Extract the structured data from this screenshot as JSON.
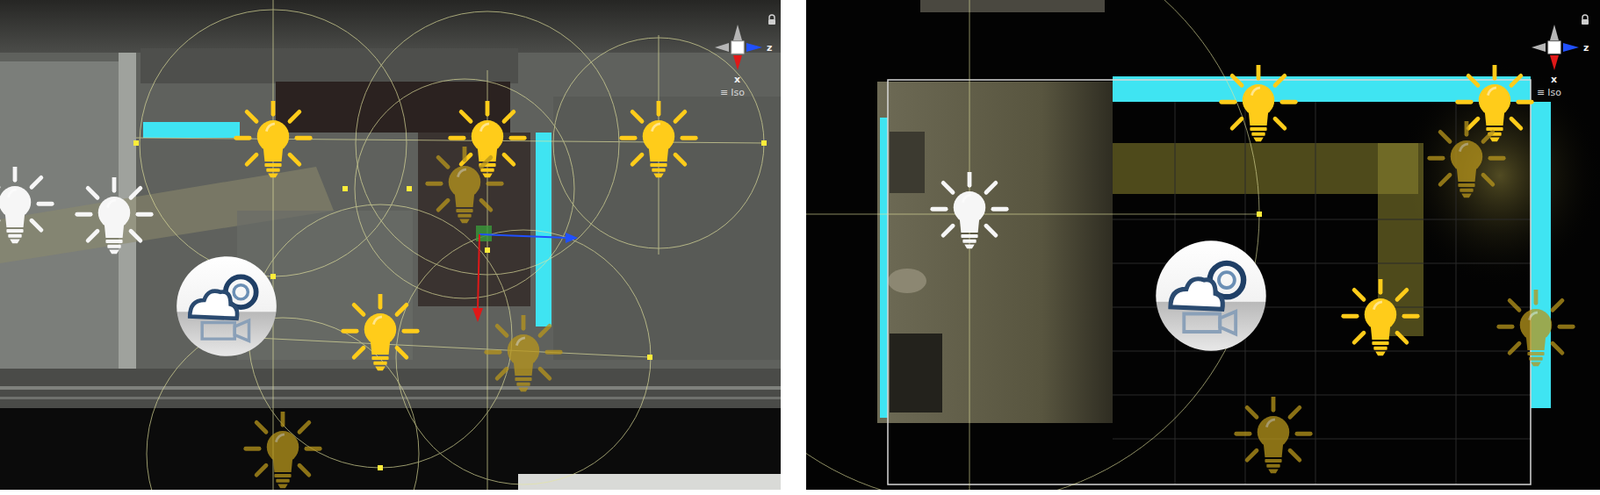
{
  "panels": [
    {
      "gizmo": {
        "x": "x",
        "z": "z",
        "menu": "≡",
        "projection": "Iso"
      },
      "lights": [
        {
          "kind": "lit",
          "selected": false
        },
        {
          "kind": "lit",
          "selected": false
        },
        {
          "kind": "lit",
          "selected": false
        },
        {
          "kind": "faded",
          "selected": true
        },
        {
          "kind": "pale",
          "selected": false
        },
        {
          "kind": "pale",
          "selected": false
        },
        {
          "kind": "lit",
          "selected": false
        },
        {
          "kind": "faded",
          "selected": false
        },
        {
          "kind": "faded",
          "selected": false
        }
      ]
    },
    {
      "gizmo": {
        "x": "x",
        "z": "z",
        "menu": "≡",
        "projection": "Iso"
      },
      "lights": [
        {
          "kind": "lit",
          "selected": false
        },
        {
          "kind": "lit",
          "selected": false
        },
        {
          "kind": "faded",
          "selected": false
        },
        {
          "kind": "pale",
          "selected": false
        },
        {
          "kind": "lit",
          "selected": false
        },
        {
          "kind": "faded",
          "selected": false
        },
        {
          "kind": "faded",
          "selected": false
        }
      ]
    }
  ]
}
